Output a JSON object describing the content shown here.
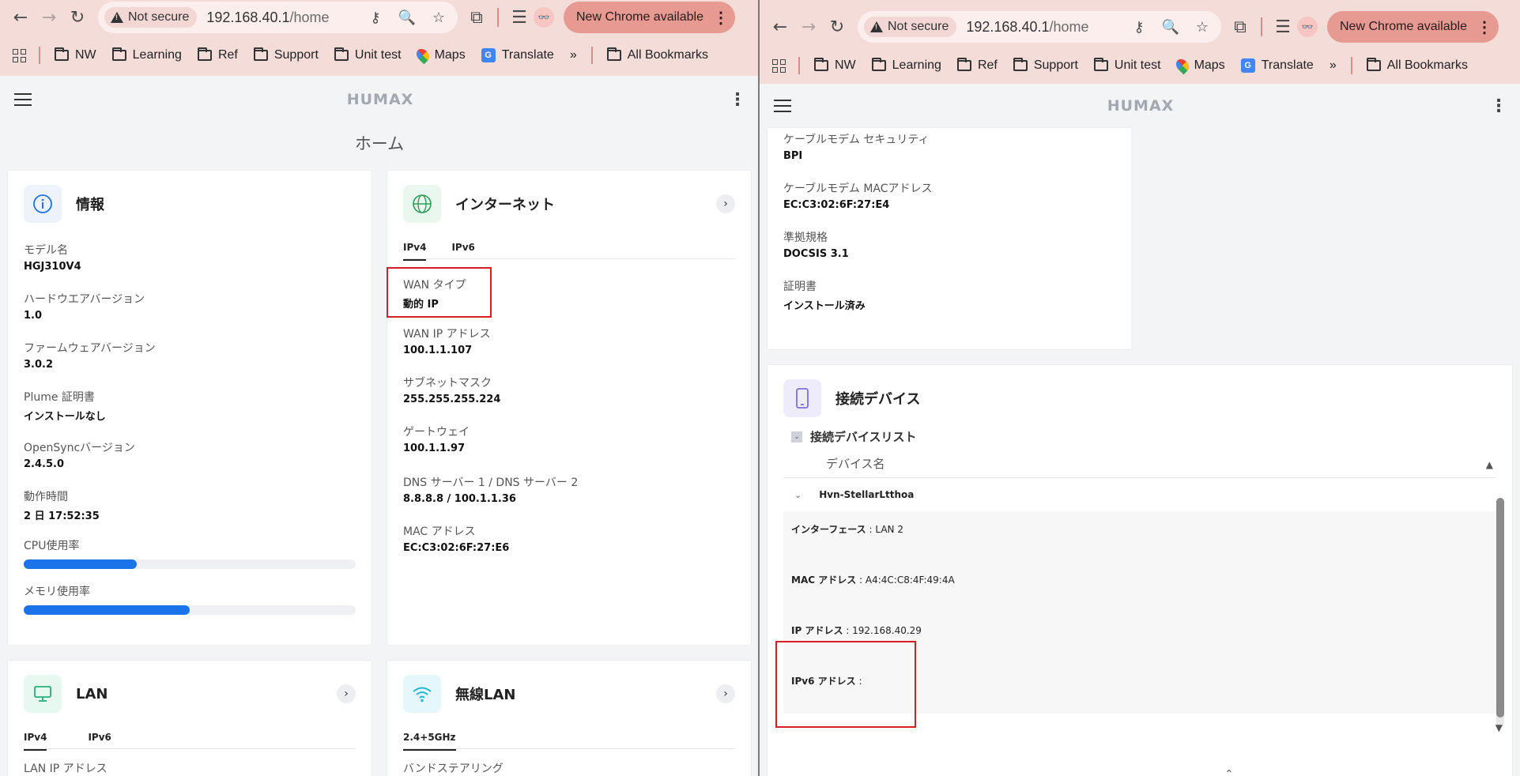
{
  "browser": {
    "not_secure": "Not secure",
    "url_host": "192.168.40.1",
    "url_path": "/home",
    "new_chrome": "New Chrome available",
    "bookmarks": [
      "NW",
      "Learning",
      "Ref",
      "Support",
      "Unit test",
      "Maps",
      "Translate"
    ],
    "all_bookmarks": "All Bookmarks"
  },
  "app": {
    "logo": "HUMAX",
    "page_title": "ホーム"
  },
  "info": {
    "title": "情報",
    "fields": [
      {
        "label": "モデル名",
        "value": "HGJ310V4"
      },
      {
        "label": "ハードウエアバージョン",
        "value": "1.0"
      },
      {
        "label": "ファームウェアバージョン",
        "value": "3.0.2"
      },
      {
        "label": "Plume 証明書",
        "value": "インストールなし"
      },
      {
        "label": "OpenSyncバージョン",
        "value": "2.4.5.0"
      },
      {
        "label": "動作時間",
        "value": "2 日 17:52:35"
      }
    ],
    "cpu_label": "CPU使用率",
    "cpu_usage": 0.34,
    "mem_label": "メモリ使用率",
    "mem_usage": 0.5
  },
  "internet": {
    "title": "インターネット",
    "tabs": [
      "IPv4",
      "IPv6"
    ],
    "fields": [
      {
        "label": "WAN タイプ",
        "value": "動的 IP"
      },
      {
        "label": "WAN IP アドレス",
        "value": "100.1.1.107"
      },
      {
        "label": "サブネットマスク",
        "value": "255.255.255.224"
      },
      {
        "label": "ゲートウェイ",
        "value": "100.1.1.97"
      },
      {
        "label": "DNS サーバー 1 / DNS サーバー 2",
        "value": "8.8.8.8 / 100.1.1.36"
      },
      {
        "label": "MAC アドレス",
        "value": "EC:C3:02:6F:27:E6"
      }
    ]
  },
  "lan": {
    "title": "LAN",
    "tabs": [
      "IPv4",
      "IPv6"
    ],
    "cut_label": "LAN IP アドレス"
  },
  "wlan": {
    "title": "無線LAN",
    "tabs": [
      "2.4+5GHz"
    ],
    "cut_label": "バンドステアリング"
  },
  "cablemodem": {
    "fields": [
      {
        "label": "ケーブルモデム セキュリティ",
        "value": "BPI"
      },
      {
        "label": "ケーブルモデム MACアドレス",
        "value": "EC:C3:02:6F:27:E4"
      },
      {
        "label": "準拠規格",
        "value": "DOCSIS 3.1"
      },
      {
        "label": "証明書",
        "value": "インストール済み"
      }
    ]
  },
  "devices": {
    "title": "接続デバイス",
    "list_title": "接続デバイスリスト",
    "col_name": "デバイス名",
    "device_name": "Hvn-StellarLtthoa",
    "rows": [
      {
        "key": "インターフェース",
        "value": "LAN 2"
      },
      {
        "key": "MAC アドレス",
        "value": "A4:4C:C8:4F:49:4A"
      },
      {
        "key": "IP アドレス",
        "value": "192.168.40.29"
      },
      {
        "key": "IPv6 アドレス",
        "value": ""
      }
    ]
  },
  "colors": {
    "accent": "#1a73e8",
    "highlight": "#d51f26",
    "toolbar": "#f4dcd9"
  }
}
